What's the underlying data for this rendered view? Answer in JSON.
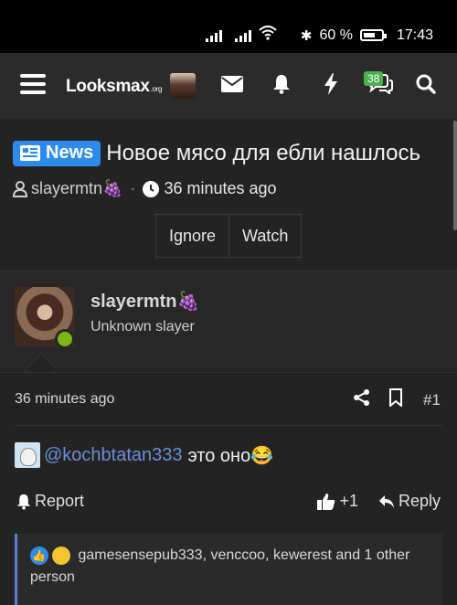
{
  "status_bar": {
    "battery": "60 %",
    "time": "17:43"
  },
  "navbar": {
    "logo_main": "Looksmax",
    "logo_suffix": ".org",
    "alerts_badge": "38"
  },
  "thread": {
    "prefix_label": "News",
    "title": "Новое мясо для ебли нашлось",
    "author": "slayermtn🍇",
    "time": "36 minutes ago",
    "buttons": {
      "ignore": "Ignore",
      "watch": "Watch"
    }
  },
  "post": {
    "username": "slayermtn🍇",
    "user_title": "Unknown slayer",
    "time": "36 minutes ago",
    "number": "#1",
    "mention": "@kochbtatan333",
    "message": "это оно😂",
    "report": "Report",
    "like_count": "+1",
    "reply": "Reply",
    "reactions_text": "gamesensepub333, venccoo, kewerest and 1 other person"
  }
}
